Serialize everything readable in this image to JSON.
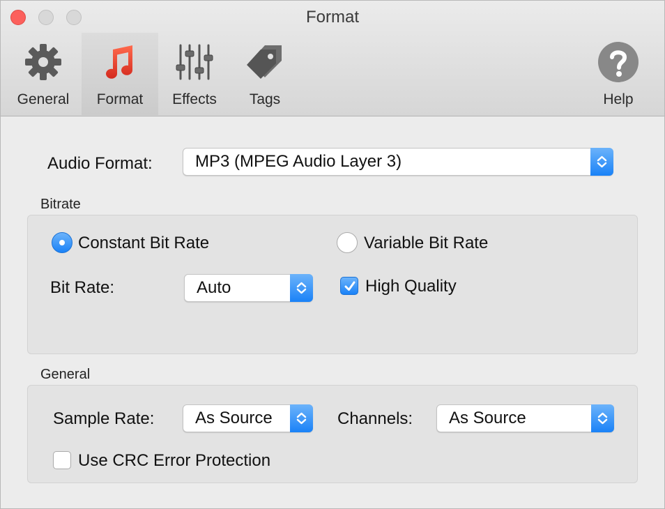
{
  "window": {
    "title": "Format"
  },
  "toolbar": {
    "items": [
      {
        "label": "General",
        "icon": "gear-icon"
      },
      {
        "label": "Format",
        "icon": "music-note-icon",
        "selected": true
      },
      {
        "label": "Effects",
        "icon": "equalizer-sliders-icon"
      },
      {
        "label": "Tags",
        "icon": "tag-icon"
      },
      {
        "label": "Help",
        "icon": "question-mark-icon"
      }
    ]
  },
  "audio_format": {
    "label": "Audio Format:",
    "value": "MP3 (MPEG Audio Layer 3)"
  },
  "bitrate": {
    "title": "Bitrate",
    "constant_label": "Constant Bit Rate",
    "constant_selected": true,
    "variable_label": "Variable Bit Rate",
    "variable_selected": false,
    "bit_rate_label": "Bit Rate:",
    "bit_rate_value": "Auto",
    "high_quality_label": "High Quality",
    "high_quality_checked": true
  },
  "general": {
    "title": "General",
    "sample_rate_label": "Sample Rate:",
    "sample_rate_value": "As Source",
    "channels_label": "Channels:",
    "channels_value": "As Source",
    "crc_label": "Use CRC Error Protection",
    "crc_checked": false
  },
  "colors": {
    "accent": "#1a82f7",
    "close": "#fc605c",
    "music_red": "#e8372b"
  }
}
